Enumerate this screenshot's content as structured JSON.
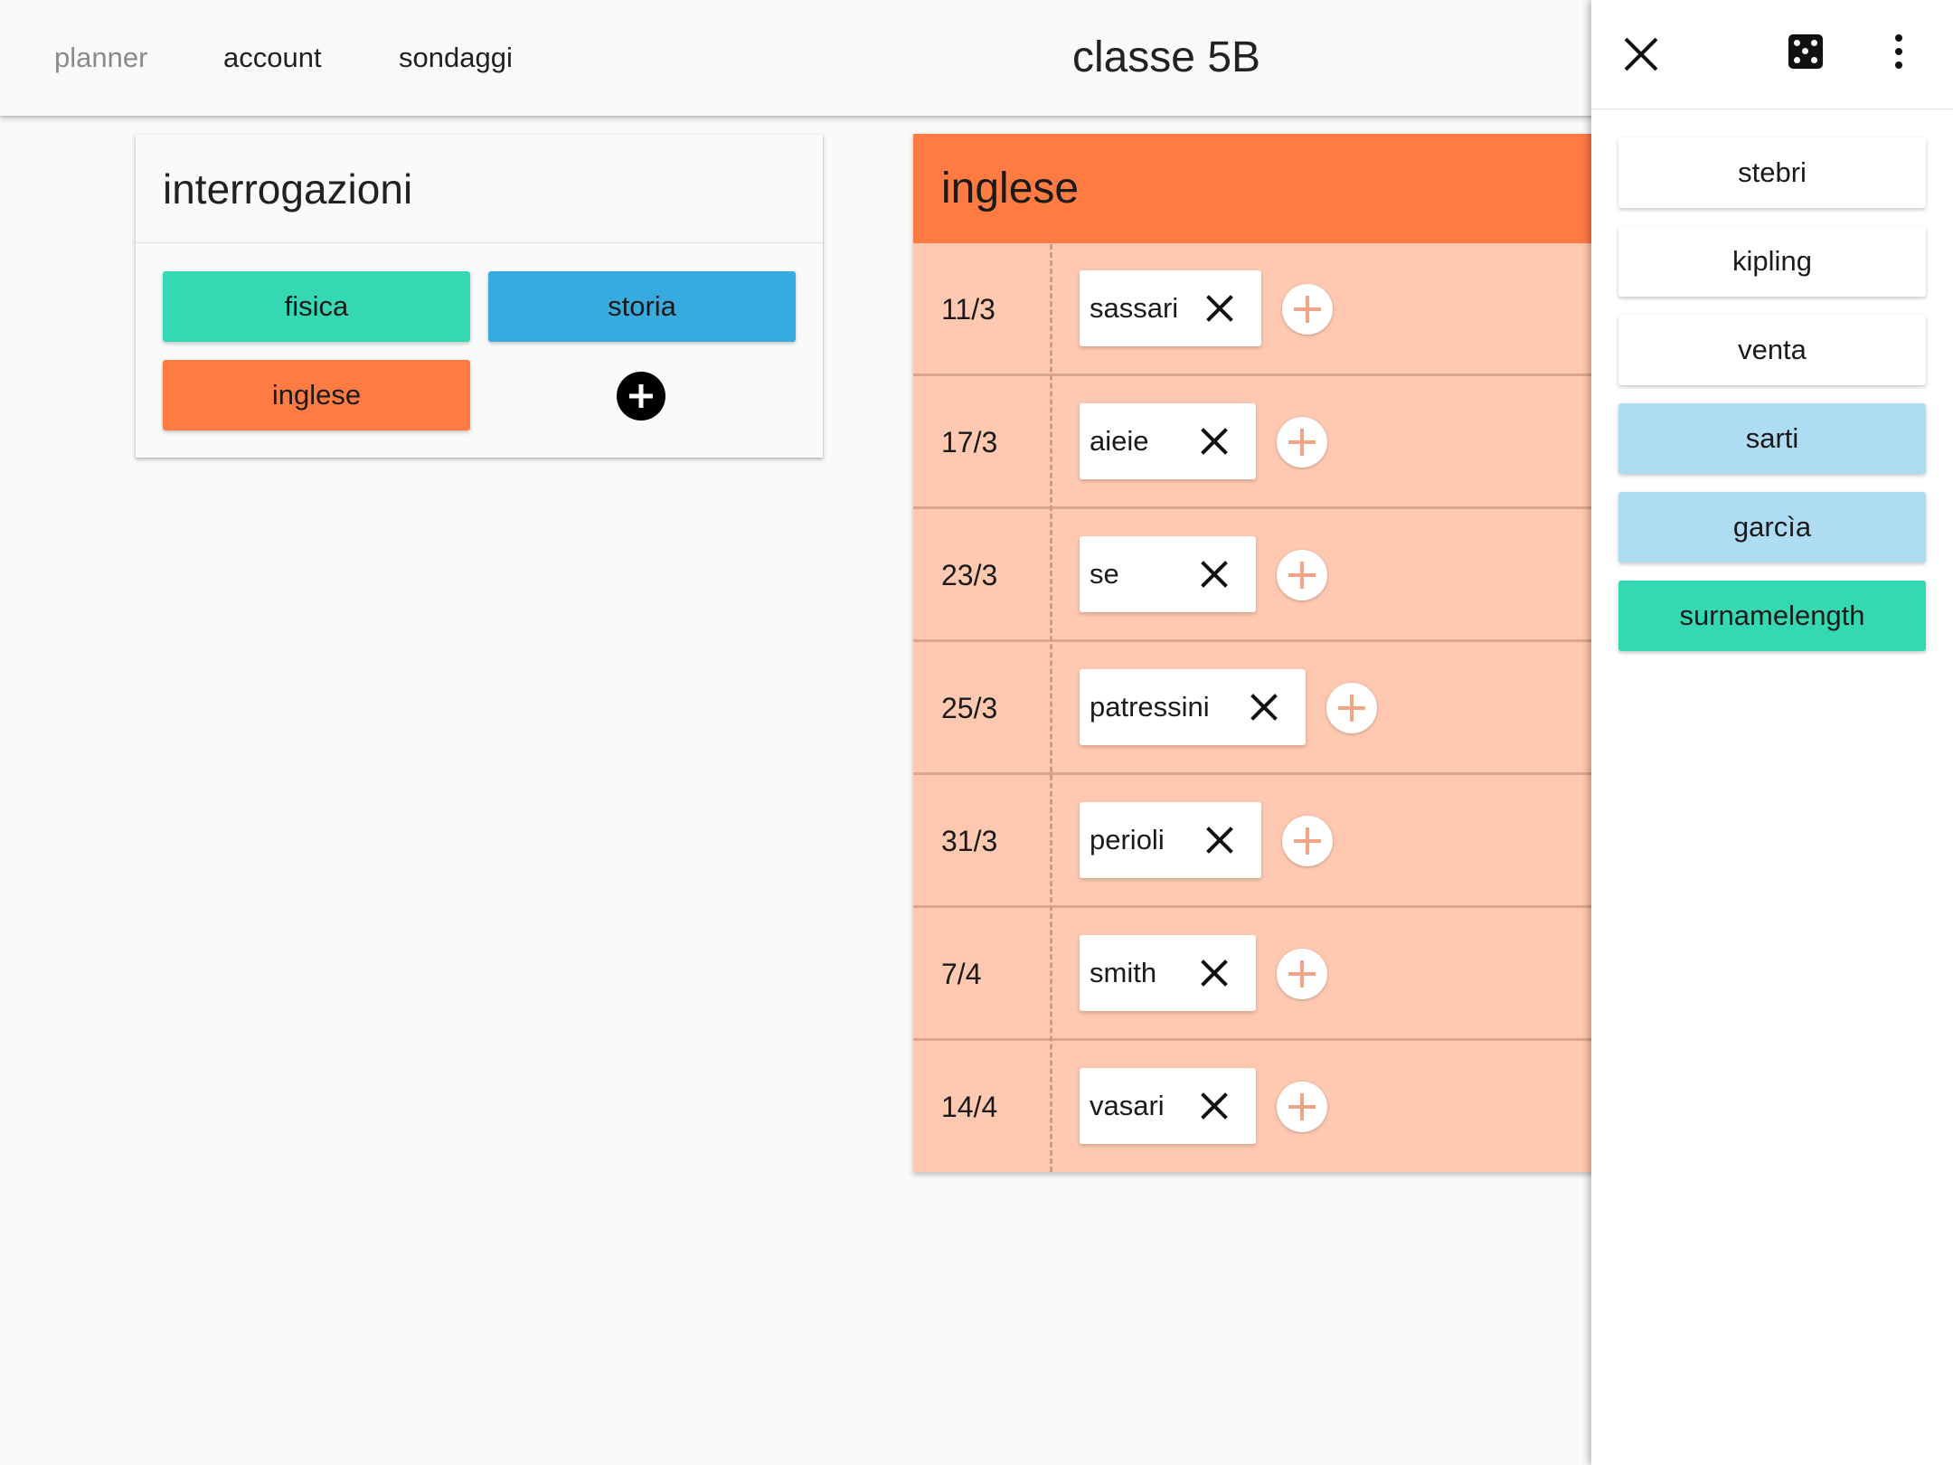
{
  "nav": {
    "links": [
      "planner",
      "account",
      "sondaggi"
    ],
    "active": "planner",
    "title": "classe 5B"
  },
  "interrogazioni": {
    "title": "interrogazioni",
    "subjects": [
      {
        "label": "fisica",
        "color": "#34d9b3"
      },
      {
        "label": "storia",
        "color": "#37abe0"
      },
      {
        "label": "inglese",
        "color": "#ff7b41"
      }
    ],
    "add_icon": "plus-circle-icon"
  },
  "subject_panel": {
    "title": "inglese",
    "header_color": "#ff7b41",
    "body_color": "#ffc8b0",
    "rows": [
      {
        "date": "11/3",
        "student": "sassari"
      },
      {
        "date": "17/3",
        "student": "aieie"
      },
      {
        "date": "23/3",
        "student": "se"
      },
      {
        "date": "25/3",
        "student": "patressini"
      },
      {
        "date": "31/3",
        "student": "perioli"
      },
      {
        "date": "7/4",
        "student": "smith"
      },
      {
        "date": "14/4",
        "student": "vasari"
      }
    ]
  },
  "drawer": {
    "icons": [
      "close-icon",
      "dice-icon",
      "more-vert-icon"
    ],
    "students": [
      {
        "name": "stebri",
        "color": "#ffffff"
      },
      {
        "name": "kipling",
        "color": "#ffffff"
      },
      {
        "name": "venta",
        "color": "#ffffff"
      },
      {
        "name": "sarti",
        "color": "#aedcf3"
      },
      {
        "name": "garcìa",
        "color": "#aedcf3"
      },
      {
        "name": "surnamelength",
        "color": "#34d9b3"
      }
    ]
  }
}
